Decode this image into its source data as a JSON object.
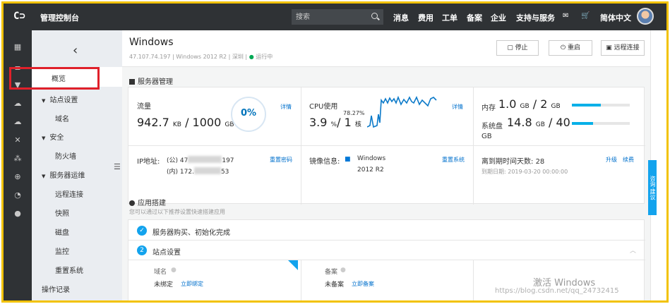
{
  "topnav": {
    "logo": "C⊃",
    "console": "管理控制台",
    "search_placeholder": "搜索",
    "items": [
      "消息",
      "费用",
      "工单",
      "备案",
      "企业",
      "支持与服务",
      "简体中文"
    ]
  },
  "sidebar": {
    "back": "‹",
    "items": {
      "overview": "概览",
      "site_settings": "站点设置",
      "domain": "域名",
      "security": "安全",
      "firewall": "防火墙",
      "server_ops": "服务器运维",
      "remote": "远程连接",
      "snapshot": "快照",
      "disk": "磁盘",
      "monitor": "监控",
      "reset": "重置系统",
      "oplog": "操作记录"
    }
  },
  "header": {
    "title": "Windows",
    "meta": "47.107.74.197 | Windows 2012 R2 | 深圳 |",
    "status": "运行中",
    "buttons": {
      "stop": "停止",
      "restart": "重启",
      "remote": "远程连接"
    }
  },
  "server_section_title": "服务器管理",
  "traffic": {
    "label": "流量",
    "used": "942.7",
    "used_unit": "KB",
    "total": "1000",
    "total_unit": "GB",
    "percent": "0%",
    "details": "详情"
  },
  "cpu": {
    "label": "CPU使用",
    "value": "3.9",
    "unit": "%",
    "cores": "1",
    "cores_unit": "核",
    "peak": "78.27%",
    "details": "详情"
  },
  "memory": {
    "label": "内存",
    "value": "1.0",
    "unit": "GB",
    "total": "2",
    "total_unit": "GB",
    "fill": 0.5
  },
  "disk": {
    "label": "系统盘",
    "value": "14.8",
    "unit": "GB",
    "total": "40",
    "total_unit": "GB",
    "fill": 0.37
  },
  "ip": {
    "label": "IP地址:",
    "public_prefix": "(公) 47",
    "public_suffix": "197",
    "private_prefix": "(内) 172.",
    "private_suffix": "53",
    "reset_pwd": "重置密码"
  },
  "image": {
    "label": "镜像信息:",
    "os": "Windows",
    "version": "2012 R2",
    "reset": "重置系统"
  },
  "expiry": {
    "label": "离到期时间天数:",
    "days": "28",
    "date_label": "到期日期:",
    "date": "2019-03-20 00:00:00",
    "upgrade": "升级",
    "renew": "续费"
  },
  "app_section": {
    "title": "应用搭建",
    "subtitle": "您可以通过以下推荐设置快速搭建应用"
  },
  "steps": {
    "step1": "服务器购买、初始化完成",
    "step2_num": "2",
    "step2": "站点设置",
    "domain_label": "域名",
    "domain_status": "未绑定",
    "domain_link": "立即绑定",
    "icp_label": "备案",
    "icp_status": "未备案",
    "icp_link": "立即备案"
  },
  "watermark": {
    "activate": "激活 Windows",
    "url": "https://blog.csdn.net/qq_24732415"
  },
  "feedback": "咨询·建议"
}
